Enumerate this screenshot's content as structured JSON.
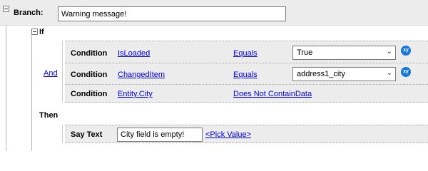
{
  "branch": {
    "label": "Branch:",
    "value": "Warning message!"
  },
  "if_block": {
    "label": "If",
    "logical_operator": "And",
    "conditions": [
      {
        "label": "Condition",
        "field": "IsLoaded",
        "operator": "Equals",
        "value": "True",
        "has_dropdown": true,
        "icon": "xy-icon"
      },
      {
        "label": "Condition",
        "field": "ChangedItem",
        "operator": "Equals",
        "value": "address1_city",
        "has_dropdown": true,
        "icon": "xy-icon"
      },
      {
        "label": "Condition",
        "field": "Entity.City",
        "operator": "Does Not ContainData"
      }
    ]
  },
  "then_block": {
    "label": "Then",
    "action": {
      "label": "Say Text",
      "value": "City field is empty!",
      "pick_label": "<Pick Value>"
    }
  },
  "icons": {
    "xy_text": "xy",
    "xy_color": "#1979d8"
  },
  "colors": {
    "row_bg": "#ececec",
    "link": "#0000ee"
  }
}
